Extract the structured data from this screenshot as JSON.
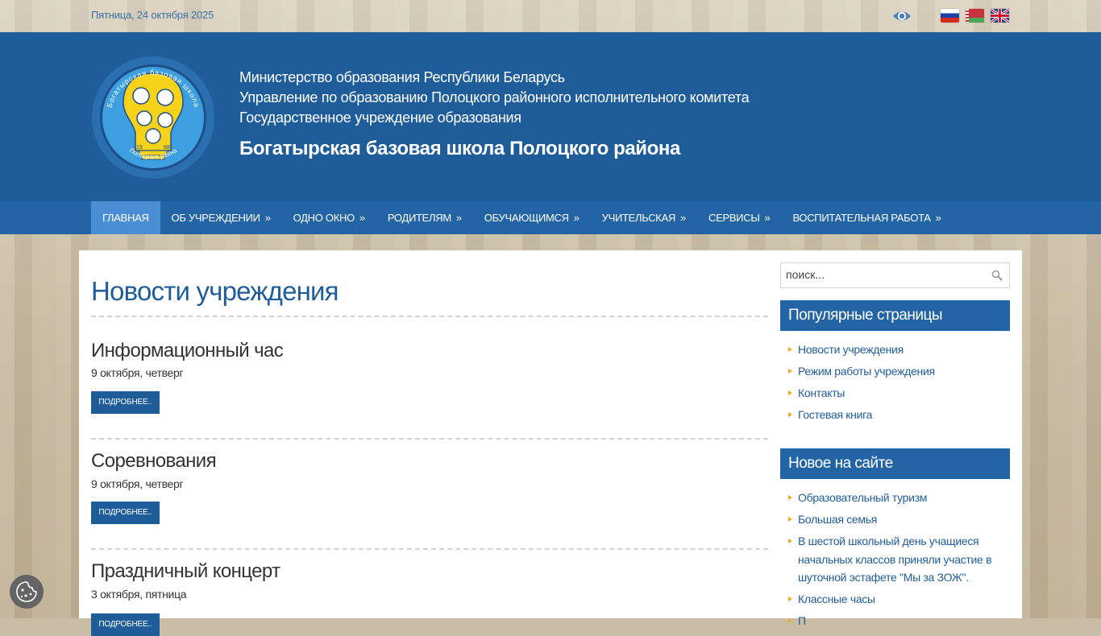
{
  "topbar": {
    "date": "Пятница, 24 октября 2025",
    "icons": [
      "eye-icon",
      "flag-ru",
      "flag-by",
      "flag-en"
    ]
  },
  "header": {
    "line1": "Министерство образования Республики Беларусь",
    "line2": "Управление по образованию Полоцкого районного исполнительного комитета",
    "line3": "Государственное учреждение образования",
    "school": "Богатырская базовая школа Полоцкого района",
    "logo": {
      "text_top": "Богатырская базовая школа",
      "text_bottom": "Полацкага раёна",
      "year_left": "19",
      "year_right": "88"
    }
  },
  "nav": {
    "items": [
      {
        "label": "Главная",
        "arrow": ""
      },
      {
        "label": "Об учреждении",
        "arrow": "»"
      },
      {
        "label": "Одно окно",
        "arrow": "»"
      },
      {
        "label": "Родителям",
        "arrow": "»"
      },
      {
        "label": "Обучающимся",
        "arrow": "»"
      },
      {
        "label": "Учительская",
        "arrow": "»"
      },
      {
        "label": "Сервисы",
        "arrow": "»"
      },
      {
        "label": "Воспитательная работа",
        "arrow": "»"
      }
    ]
  },
  "main": {
    "title": "Новости учреждения",
    "news": [
      {
        "title": "Информационный час",
        "date": "9 октября, четверг",
        "more": "Подробнее.."
      },
      {
        "title": "Соревнования",
        "date": "9 октября, четверг",
        "more": "Подробнее.."
      },
      {
        "title": "Праздничный концерт",
        "date": "3 октября, пятница",
        "more": "Подробнее.."
      }
    ]
  },
  "sidebar": {
    "search_placeholder": "поиск...",
    "popular": {
      "title": "Популярные страницы",
      "items": [
        "Новости учреждения",
        "Режим работы учреждения",
        "Контакты",
        "Гостевая книга"
      ]
    },
    "new": {
      "title": "Новое на сайте",
      "items": [
        "Образовательный туризм",
        "Большая семья",
        "В шестой школьный день учащиеся начальных классов приняли участие в шуточной эстафете \"Мы за ЗОЖ\".",
        "Классные часы",
        "П"
      ]
    }
  },
  "colors": {
    "header_blue": "#1f5d9a",
    "nav_blue": "#2364a4",
    "nav_active": "#4a8fd4",
    "bullet_orange": "#f0a830"
  }
}
